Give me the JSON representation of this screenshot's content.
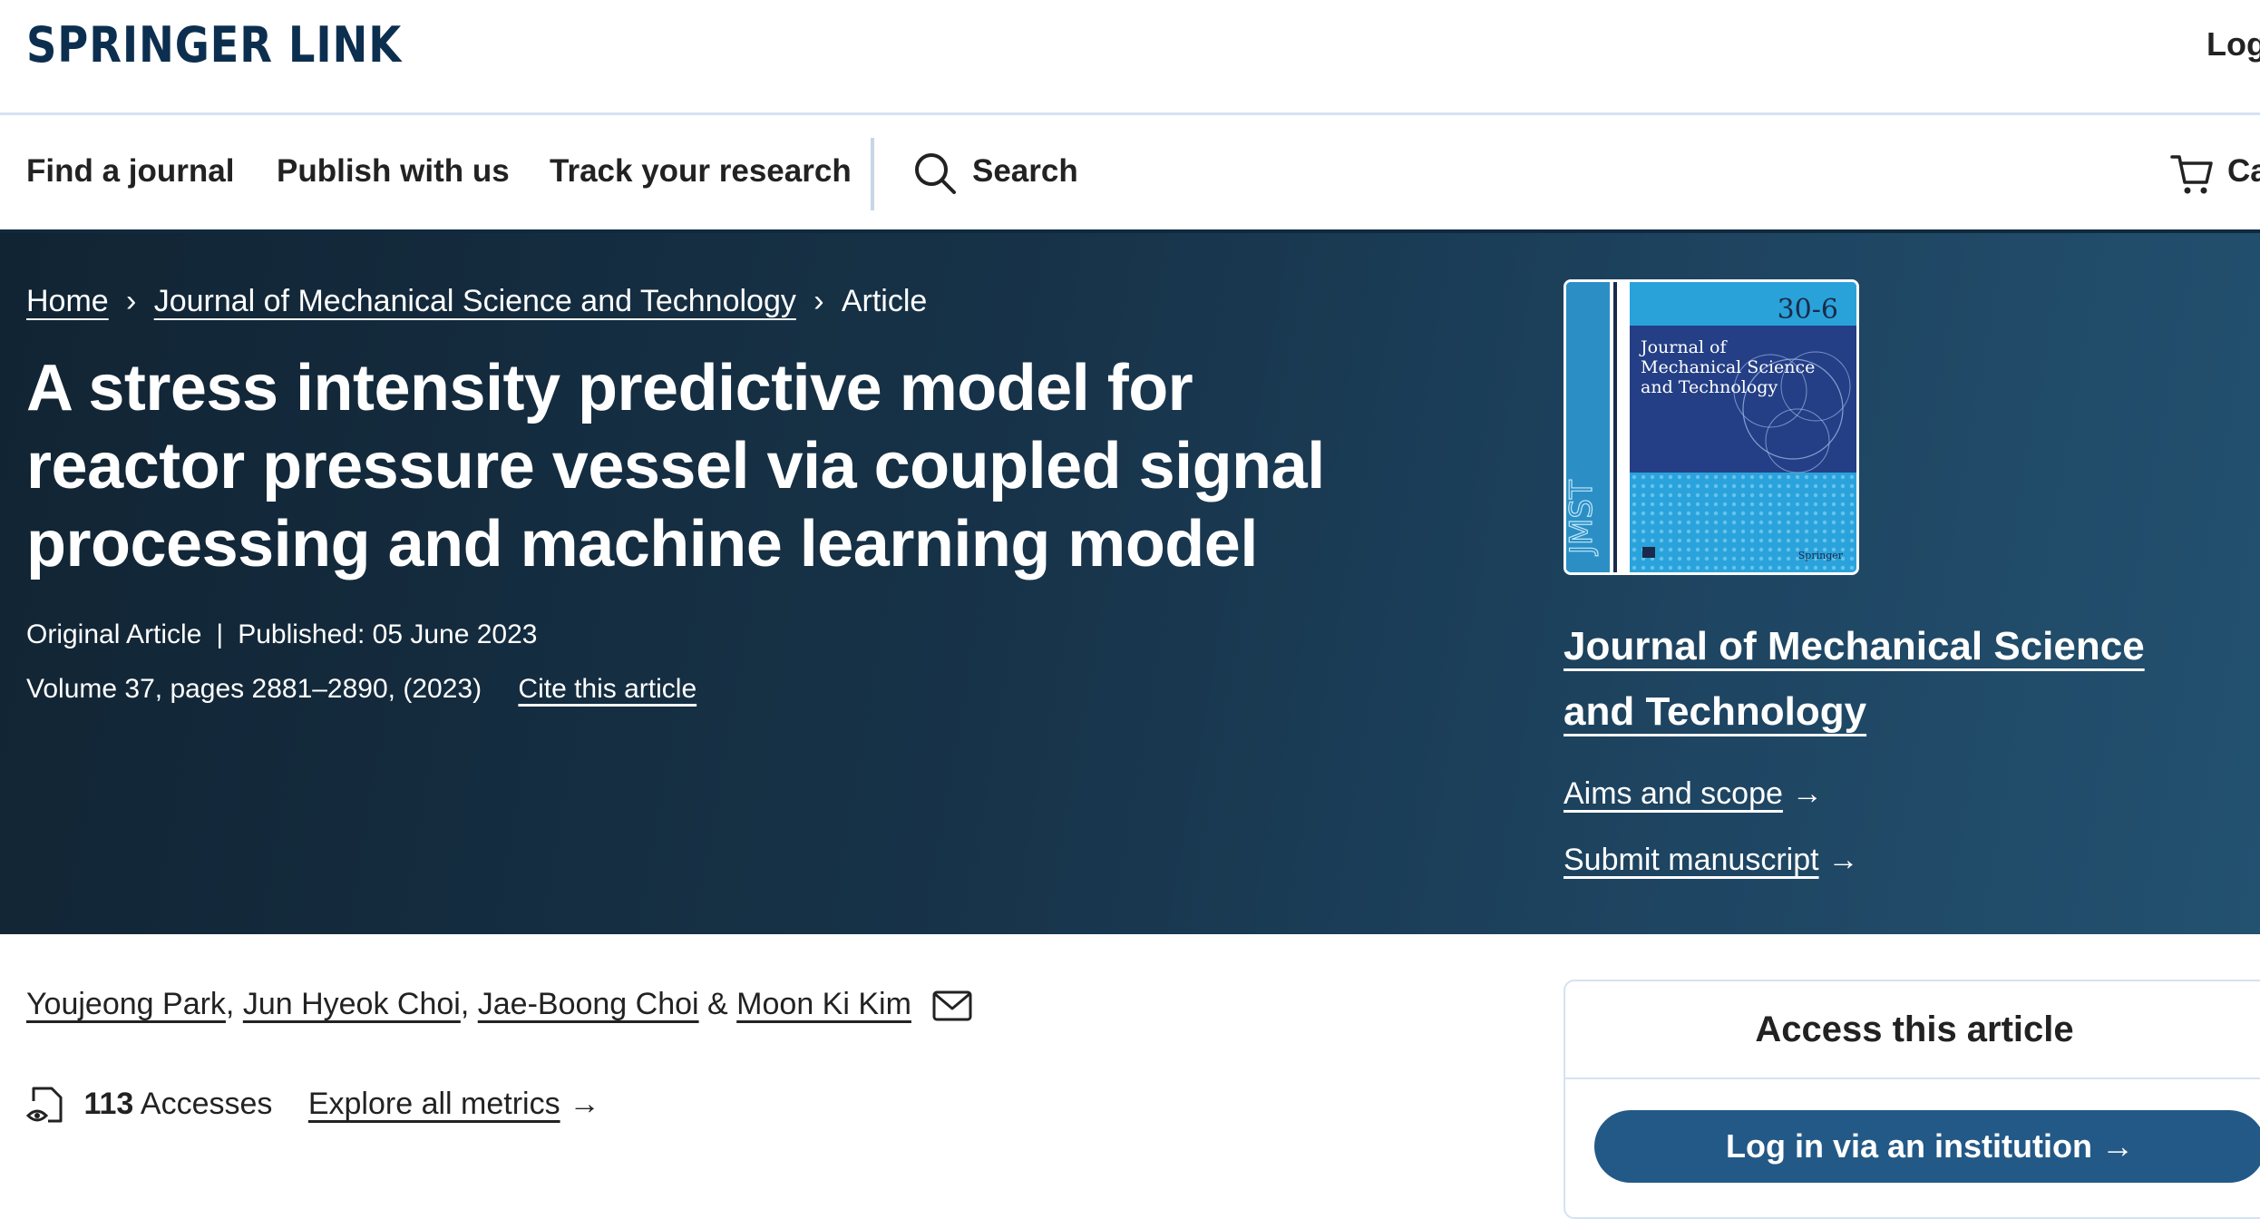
{
  "header": {
    "logo": "SPRINGER LINK",
    "login": "Log"
  },
  "nav": {
    "find_journal": "Find a journal",
    "publish": "Publish with us",
    "track": "Track your research",
    "search": "Search",
    "cart": "Ca"
  },
  "breadcrumb": {
    "home": "Home",
    "journal": "Journal of Mechanical Science and Technology",
    "current": "Article",
    "separator": "›"
  },
  "article": {
    "title": "A stress intensity predictive model for reactor pressure vessel via coupled signal processing and machine learning model",
    "type": "Original Article",
    "published": "Published: 05 June 2023",
    "volume": "Volume 37, pages 2881–2890, (2023)",
    "cite": "Cite this article"
  },
  "journal_panel": {
    "cover_issue": "30-6",
    "cover_title_l1": "Journal of",
    "cover_title_l2": "Mechanical Science",
    "cover_title_l3": "and Technology",
    "cover_publisher": "Springer",
    "cover_spine": "JMST",
    "name": "Journal of Mechanical Science and Technology",
    "aims": "Aims and scope",
    "submit": "Submit manuscript",
    "arrow": "→"
  },
  "authors": {
    "a1": "Youjeong Park",
    "a2": "Jun Hyeok Choi",
    "a3": "Jae-Boong Choi",
    "a4": "Moon Ki Kim",
    "sep_comma": ",",
    "sep_amp": "&"
  },
  "metrics": {
    "count": "113",
    "label": "Accesses",
    "explore": "Explore all metrics",
    "arrow": "→"
  },
  "access": {
    "title": "Access this article",
    "button": "Log in via an institution",
    "arrow": "→"
  },
  "colors": {
    "brand_navy": "#0d2f4f",
    "hero_dark": "#112433",
    "hero_light": "#235170",
    "button_blue": "#235987",
    "divider": "#d5e3f2"
  }
}
